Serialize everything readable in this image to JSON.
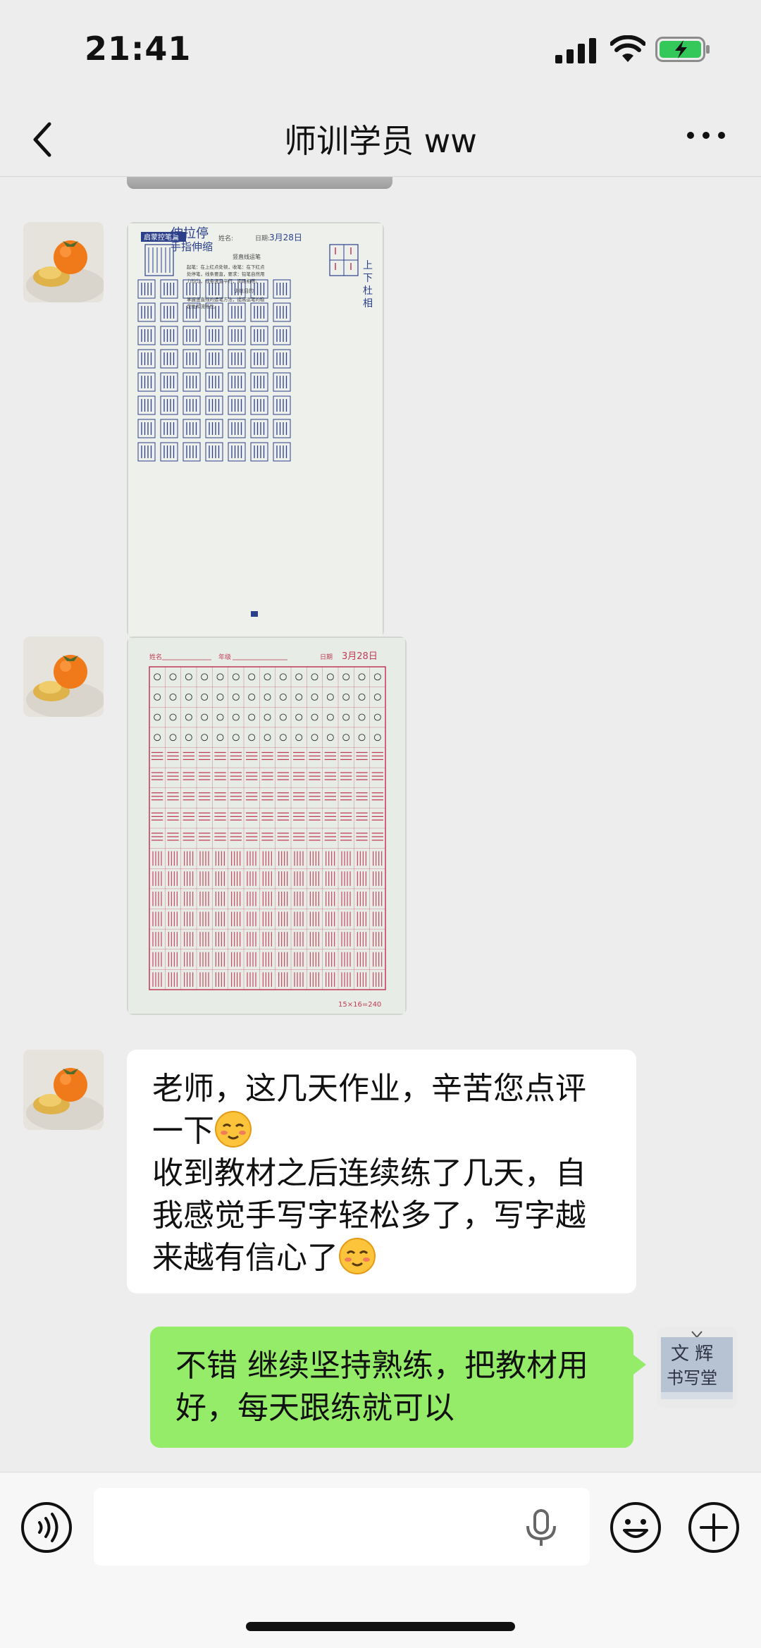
{
  "status_bar": {
    "time": "21:41"
  },
  "header": {
    "title": "师训学员 ww"
  },
  "messages": {
    "text_in": {
      "line1": "老师，这几天作业，辛苦您点评",
      "line2": "一下",
      "line3": "收到教材之后连续练了几天，自",
      "line4": "我感觉手写字轻松多了，写字越",
      "line5": "来越有信心了"
    },
    "text_out": {
      "line1": "不错 继续坚持熟练，把教材用",
      "line2": "好，每天跟练就可以"
    }
  },
  "worksheet1": {
    "header_label": "启蒙控笔篇",
    "title_line1": "伸拉停",
    "title_line2": "手指伸缩",
    "name_label": "姓名:",
    "date_label": "日期:",
    "date_value": "3月28日",
    "note_title": "竖直线运笔",
    "note1": "起笔：在上红点处顿，收笔：在下红点",
    "note2": "处停笔，线条要直，要求：铅笔自然用",
    "note3": "力均匀，线条竖直平行，间距相等。",
    "goal_title": "训练目的",
    "goal1": "掌握竖直线的运笔方法，提高运笔的稳",
    "goal2": "定性和流畅性。",
    "side_note1": "上",
    "side_note2": "下",
    "side_note3": "杜",
    "side_note4": "相"
  },
  "worksheet2": {
    "name_label": "姓名",
    "grade_label": "年级",
    "date_label": "日期",
    "date_value": "3月28日",
    "footer": "15×16=240"
  },
  "avatars": {
    "me_avatar_line1": "文 辉",
    "me_avatar_line2": "书写堂"
  },
  "icons": {
    "back": "chevron-left-icon",
    "more": "more-dots-icon",
    "voice": "voice-mode-icon",
    "mic": "microphone-icon",
    "emoji": "emoji-icon",
    "plus": "plus-icon"
  },
  "colors": {
    "background": "#ededed",
    "outgoing_bubble": "#95ec69",
    "incoming_bubble": "#ffffff",
    "sheet1_ink": "#2b3f8a",
    "sheet2_ink": "#c23a54"
  }
}
